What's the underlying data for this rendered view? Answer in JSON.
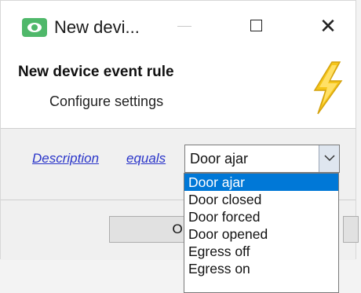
{
  "window": {
    "title": "New devi...",
    "controls": {
      "minimize": "—",
      "maximize": "□",
      "close": "✕"
    }
  },
  "header": {
    "title": "New device event rule",
    "subtitle": "Configure settings",
    "icon": "lightning-bolt-icon"
  },
  "rule": {
    "field_link": "Description",
    "operator_link": "equals",
    "selected_value": "Door ajar"
  },
  "dropdown": {
    "options": [
      {
        "label": "Door ajar",
        "selected": true
      },
      {
        "label": "Door closed",
        "selected": false
      },
      {
        "label": "Door forced",
        "selected": false
      },
      {
        "label": "Door opened",
        "selected": false
      },
      {
        "label": "Egress off",
        "selected": false
      },
      {
        "label": "Egress on",
        "selected": false
      }
    ]
  },
  "footer": {
    "ok_label": "OK"
  },
  "colors": {
    "accent": "#0078d7",
    "link": "#2a35c9",
    "bolt": "#f5c518",
    "app_icon": "#4fb86a"
  }
}
